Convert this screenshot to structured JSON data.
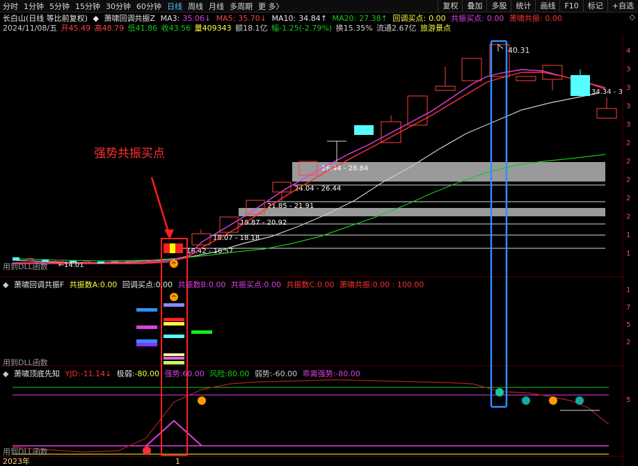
{
  "toolbar": {
    "tabs": [
      "分时",
      "1分钟",
      "5分钟",
      "15分钟",
      "30分钟",
      "60分钟",
      "日线",
      "周线",
      "月线",
      "多周期",
      "更 多〉"
    ],
    "active_tab": "日线",
    "right_buttons": [
      "复权",
      "叠加",
      "多股",
      "统计",
      "画线",
      "F10",
      "标记",
      "+自选"
    ]
  },
  "main_header": {
    "stock": "长白山(日线 等比前复权)",
    "indicator": "萧啸回调共振Z",
    "ma3_label": "MA3:",
    "ma3": "35.06↓",
    "ma5_label": "MA5:",
    "ma5": "35.70↓",
    "ma10_label": "MA10:",
    "ma10": "34.84↑",
    "ma20_label": "MA20:",
    "ma20": "27.38↑",
    "pullback_label": "回调买点:",
    "pullback": "0.00",
    "resonance_buy_label": "共振买点:",
    "resonance_buy": "0.00",
    "resonance_label": "萧啸共振:",
    "resonance": "0.00"
  },
  "quote": {
    "date": "2024/11/08/五",
    "open": "开45.49",
    "high": "高48.79",
    "low": "低41.86",
    "close": "收43.56",
    "volume": "量409343",
    "amount": "额18.1亿",
    "change": "幅-1.25(-2.79%)",
    "turnover": "换15.35%",
    "float": "流通2.67亿",
    "sector": "旅游景点"
  },
  "annotation": "强势共振买点",
  "price_labels": {
    "peak": "40.31",
    "low": "14.01",
    "right": "34.34 - 3",
    "zones": [
      "26.44 - 28.84",
      "24.04 - 26.44",
      "21.85 - 21.91",
      "19.87 - 20.92",
      "18.07 - 18.18",
      "16.42 - 16.57"
    ]
  },
  "dll_labels": [
    "用到DLL函数",
    "用到DLL函数",
    "用到DLL函数"
  ],
  "panel2_header": {
    "name": "萧啸回调共振F",
    "a_label": "共振数A:",
    "a": "0.00",
    "pullback_label": "回调买点:",
    "pullback": "0.00",
    "b_label": "共振数B:",
    "b": "0.00",
    "buy_label": "共振买点:",
    "buy": "0.00",
    "c_label": "共振数C:",
    "c": "0.00",
    "res_label": "萧啸共振:",
    "res": "0.00 : 100.00"
  },
  "panel3_header": {
    "name": "萧啸顶底先知",
    "yjd_label": "YJD:",
    "yjd": "-11.14↓",
    "weak_label": "极弱:",
    "weak": "-80.00",
    "strong_label": "强势:",
    "strong": "60.00",
    "risk_label": "风险:",
    "risk": "80.00",
    "weak2_label": "弱势:",
    "weak2": "-60.00",
    "away_label": "乖离强势:",
    "away": "-80.00"
  },
  "axis": {
    "year": "2023年",
    "tick": "1"
  },
  "right_axis_main": [
    "4",
    "3",
    "3",
    "3",
    "3",
    "2",
    "2",
    "2",
    "2",
    "2",
    "1",
    "1"
  ],
  "right_axis_p2": [
    "1",
    "7",
    "5",
    "2"
  ],
  "right_axis_p3": [
    "5"
  ],
  "colors": {
    "red": "#ff3030",
    "up": "#ff4040",
    "cyan": "#5ff",
    "magenta": "#e040e0",
    "yellow": "#ffff00",
    "green": "#18c818",
    "white": "#e8e8e8",
    "blue_box": "#2f8fff"
  }
}
